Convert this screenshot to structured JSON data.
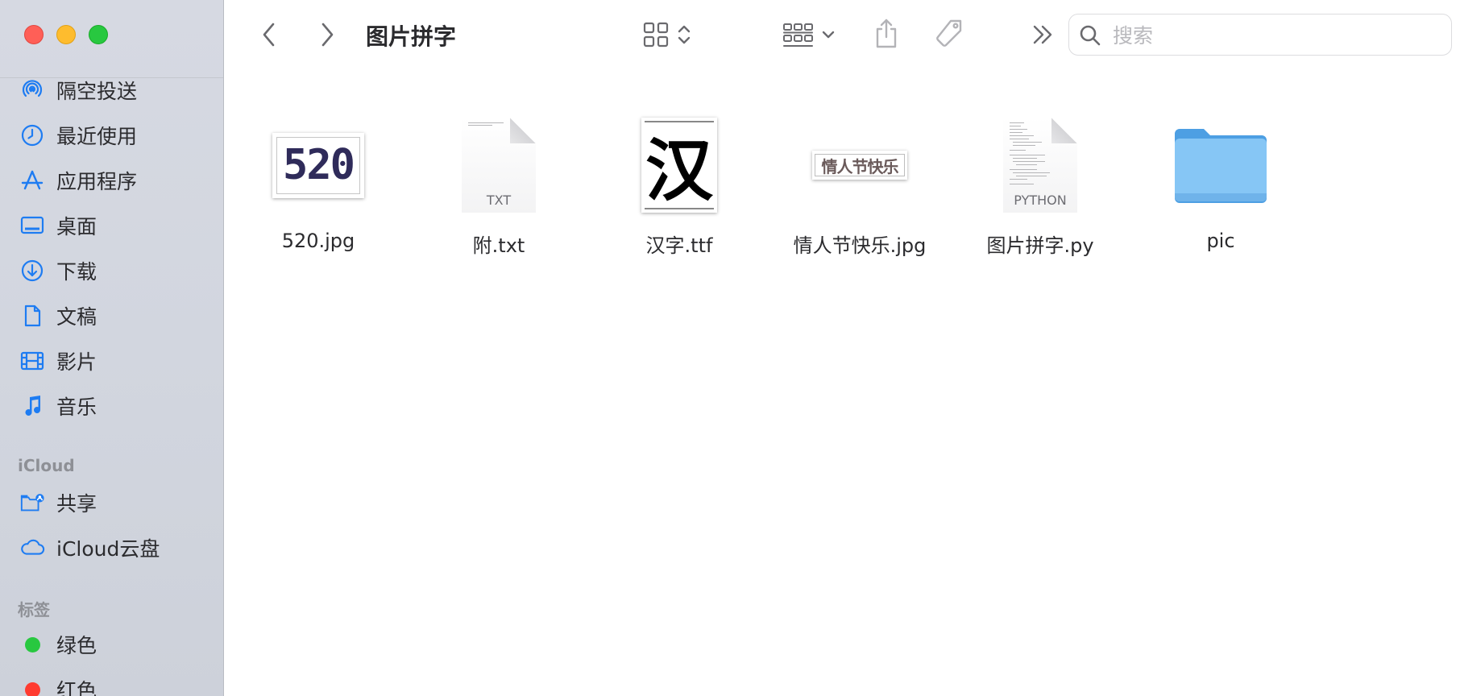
{
  "window": {
    "title": "图片拼字"
  },
  "search": {
    "placeholder": "搜索",
    "value": ""
  },
  "sidebar": {
    "items": [
      {
        "label": "隔空投送",
        "icon": "airdrop-icon"
      },
      {
        "label": "最近使用",
        "icon": "clock-icon"
      },
      {
        "label": "应用程序",
        "icon": "applications-icon"
      },
      {
        "label": "桌面",
        "icon": "desktop-icon"
      },
      {
        "label": "下载",
        "icon": "download-icon"
      },
      {
        "label": "文稿",
        "icon": "document-icon"
      },
      {
        "label": "影片",
        "icon": "film-icon"
      },
      {
        "label": "音乐",
        "icon": "music-icon"
      }
    ],
    "icloud_header": "iCloud",
    "icloud_items": [
      {
        "label": "共享",
        "icon": "shared-folder-icon"
      },
      {
        "label": "iCloud云盘",
        "icon": "cloud-icon"
      }
    ],
    "tags_header": "标签",
    "tags": [
      {
        "label": "绿色",
        "color": "#28c840"
      },
      {
        "label": "红色",
        "color": "#ff3b30"
      }
    ]
  },
  "files": [
    {
      "name": "520.jpg",
      "kind": "image",
      "thumb_text": "520"
    },
    {
      "name": "附.txt",
      "kind": "document",
      "type_label": "TXT"
    },
    {
      "name": "汉字.ttf",
      "kind": "font",
      "thumb_text": "汉"
    },
    {
      "name": "情人节快乐.jpg",
      "kind": "image",
      "thumb_text": "情人节快乐"
    },
    {
      "name": "图片拼字.py",
      "kind": "document",
      "type_label": "PYTHON"
    },
    {
      "name": "pic",
      "kind": "folder"
    }
  ],
  "colors": {
    "accent": "#1e7cf2",
    "sidebar_bg": "#d4d7df",
    "folder": "#6fb6ef"
  }
}
